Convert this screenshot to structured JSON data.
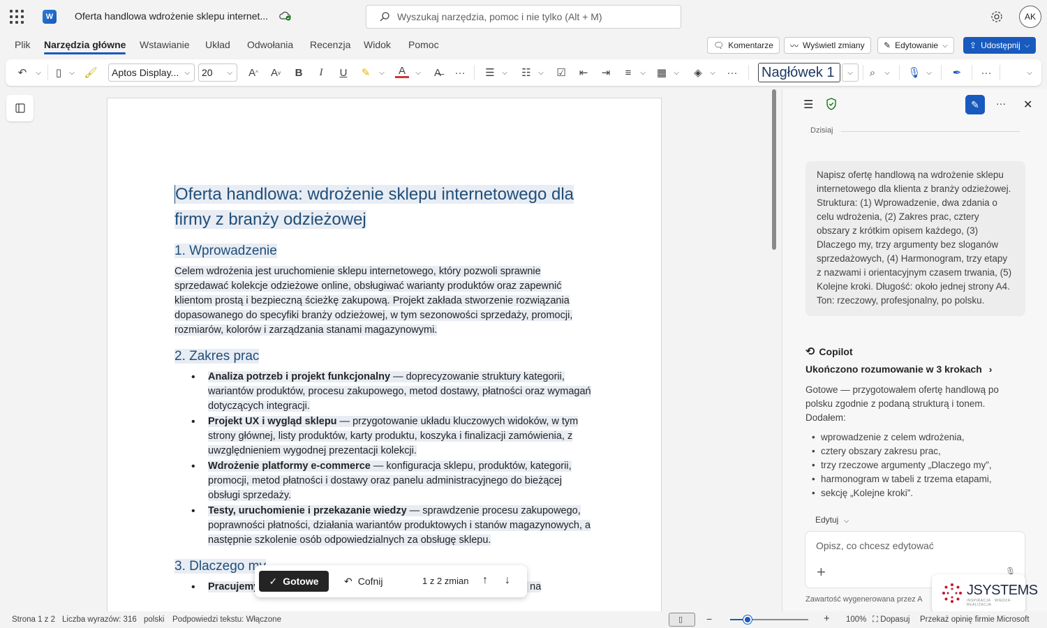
{
  "titlebar": {
    "doc_title": "Oferta handlowa wdrożenie sklepu internet...",
    "search_placeholder": "Wyszukaj narzędzia, pomoc i nie tylko (Alt + M)",
    "avatar_initials": "AK"
  },
  "tabs": [
    {
      "label": "Plik"
    },
    {
      "label": "Narzędzia główne"
    },
    {
      "label": "Wstawianie"
    },
    {
      "label": "Układ"
    },
    {
      "label": "Odwołania"
    },
    {
      "label": "Recenzja"
    },
    {
      "label": "Widok"
    },
    {
      "label": "Pomoc"
    }
  ],
  "tab_buttons": {
    "comments": "Komentarze",
    "show_changes": "Wyświetl zmiany",
    "editing": "Edytowanie",
    "share": "Udostępnij"
  },
  "ribbon": {
    "font_name": "Aptos Display...",
    "font_size": "20",
    "style_name": "Nagłówek 1"
  },
  "document": {
    "title": "Oferta handlowa: wdrożenie sklepu internetowego dla firmy z branży odzieżowej",
    "h1_intro": "1. Wprowadzenie",
    "intro_text": "Celem wdrożenia jest uruchomienie sklepu internetowego, który pozwoli sprawnie sprzedawać kolekcje odzieżowe online, obsługiwać warianty produktów oraz zapewnić klientom prostą i bezpieczną ścieżkę zakupową. Projekt zakłada stworzenie rozwiązania dopasowanego do specyfiki branży odzieżowej, w tym sezonowości sprzedaży, promocji, rozmiarów, kolorów i zarządzania stanami magazynowymi.",
    "h1_scope": "2. Zakres prac",
    "scope_items": [
      {
        "bold": "Analiza potrzeb i projekt funkcjonalny",
        "text": " — doprecyzowanie struktury kategorii, wariantów produktów, procesu zakupowego, metod dostawy, płatności oraz wymagań dotyczących integracji."
      },
      {
        "bold": "Projekt UX i wygląd sklepu",
        "text": " — przygotowanie układu kluczowych widoków, w tym strony głównej, listy produktów, karty produktu, koszyka i finalizacji zamówienia, z uwzględnieniem wygodnej prezentacji kolekcji."
      },
      {
        "bold": "Wdrożenie platformy e-commerce",
        "text": " — konfiguracja sklepu, produktów, kategorii, promocji, metod płatności i dostawy oraz panelu administracyjnego do bieżącej obsługi sprzedaży."
      },
      {
        "bold": "Testy, uruchomienie i przekazanie wiedzy",
        "text": " — sprawdzenie procesu zakupowego, poprawności płatności, działania wariantów produktowych i stanów magazynowych, a następnie szkolenie osób odpowiedzialnych za obsługę sklepu."
      }
    ],
    "h1_why": "3. Dlaczego my",
    "why_first_bold": "Pracujemy od procesu sprzedaży, nie tylko od wyglądu strony.",
    "why_first_text": " Już na"
  },
  "changebar": {
    "done": "Gotowe",
    "undo": "Cofnij",
    "count": "1 z 2 zmian"
  },
  "copilot": {
    "today": "Dzisiaj",
    "prompt": "Napisz ofertę handlową na wdrożenie sklepu internetowego dla klienta z branży odzieżowej. Struktura: (1) Wprowadzenie, dwa zdania o celu wdrożenia, (2) Zakres prac, cztery obszary z krótkim opisem każdego, (3) Dlaczego my, trzy argumenty bez sloganów sprzedażowych, (4) Harmonogram, trzy etapy z nazwami i orientacyjnym czasem trwania, (5) Kolejne kroki. Długość: około jednej strony A4. Ton: rzeczowy, profesjonalny, po polsku.",
    "label": "Copilot",
    "steps": "Ukończono rozumowanie w 3 krokach",
    "response": "Gotowe — przygotowałem ofertę handlową po polsku zgodnie z podaną strukturą i tonem. Dodałem:",
    "items": [
      "wprowadzenie z celem wdrożenia,",
      "cztery obszary zakresu prac,",
      "trzy rzeczowe argumenty „Dlaczego my”,",
      "harmonogram w tabeli z trzema etapami,",
      "sekcję „Kolejne kroki”."
    ],
    "edit_mode": "Edytuj",
    "compose_placeholder": "Opisz, co chcesz edytować",
    "disclaimer": "Zawartość wygenerowana przez A"
  },
  "watermark": {
    "brand": "JSYSTEMS",
    "tagline": "INSPIRACJA · WIEDZA · REALIZACJA"
  },
  "statusbar": {
    "page": "Strona 1 z 2",
    "words": "Liczba wyrazów: 316",
    "language": "polski",
    "predictions": "Podpowiedzi tekstu: Włączone",
    "zoom": "100%",
    "fit": "Dopasuj",
    "feedback": "Przekaż opinię firmie Microsoft",
    "zoom_fraction": 0.22
  },
  "colors": {
    "accent": "#185abd",
    "heading": "#1f4e79"
  }
}
